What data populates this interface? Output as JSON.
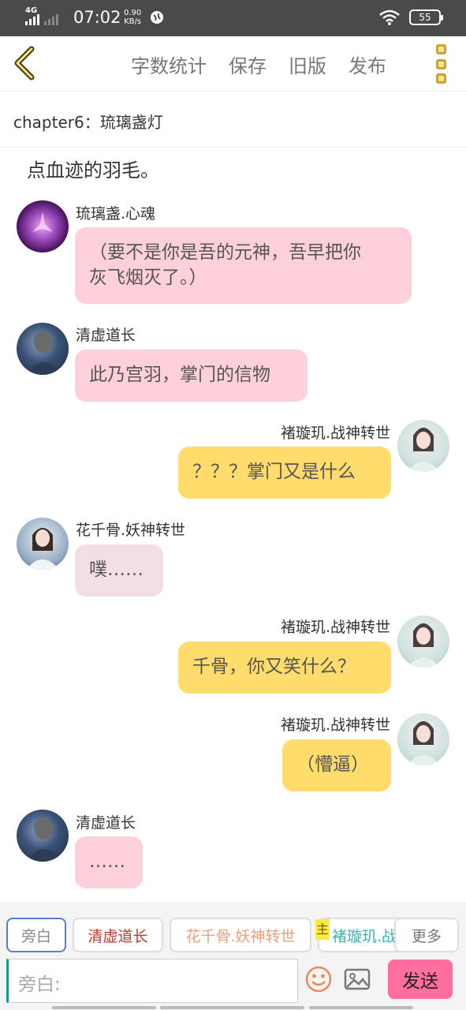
{
  "status": {
    "network": "4G",
    "time": "07:02",
    "speed_value": "0.90",
    "speed_unit": "KB/s",
    "battery": "55"
  },
  "topbar": {
    "menu": [
      "字数统计",
      "保存",
      "旧版",
      "发布"
    ]
  },
  "chapter": {
    "title": "chapter6：琉璃盏灯"
  },
  "chat": {
    "narration": "点血迹的羽毛。",
    "messages": [
      {
        "name": "琉璃盏.心魂",
        "text_line1": "（要不是你是吾的元神，吾早把你",
        "text_line2": "灰飞烟灭了。）"
      },
      {
        "name": "清虚道长",
        "text": "此乃宫羽，掌门的信物"
      },
      {
        "name": "褚璇玑.战神转世",
        "text": "？？？掌门又是什么"
      },
      {
        "name": "花千骨.妖神转世",
        "text": "噗……"
      },
      {
        "name": "褚璇玑.战神转世",
        "text": "千骨，你又笑什么？"
      },
      {
        "name": "褚璇玑.战神转世",
        "text": "（懵逼）"
      },
      {
        "name": "清虚道长",
        "text": "……"
      }
    ]
  },
  "bottom": {
    "chips": [
      "旁白",
      "清虚道长",
      "花千骨.妖神转世",
      "褚璇玑.战",
      "更多"
    ],
    "main_badge": "主",
    "input_placeholder": "旁白:",
    "send_label": "发送",
    "colors": {
      "chip_qingxu": "#c0392b",
      "chip_huaqiangu": "#e8a07a",
      "chip_chuxuanji": "#3bb3b0",
      "send": "#ff6f9e"
    }
  }
}
